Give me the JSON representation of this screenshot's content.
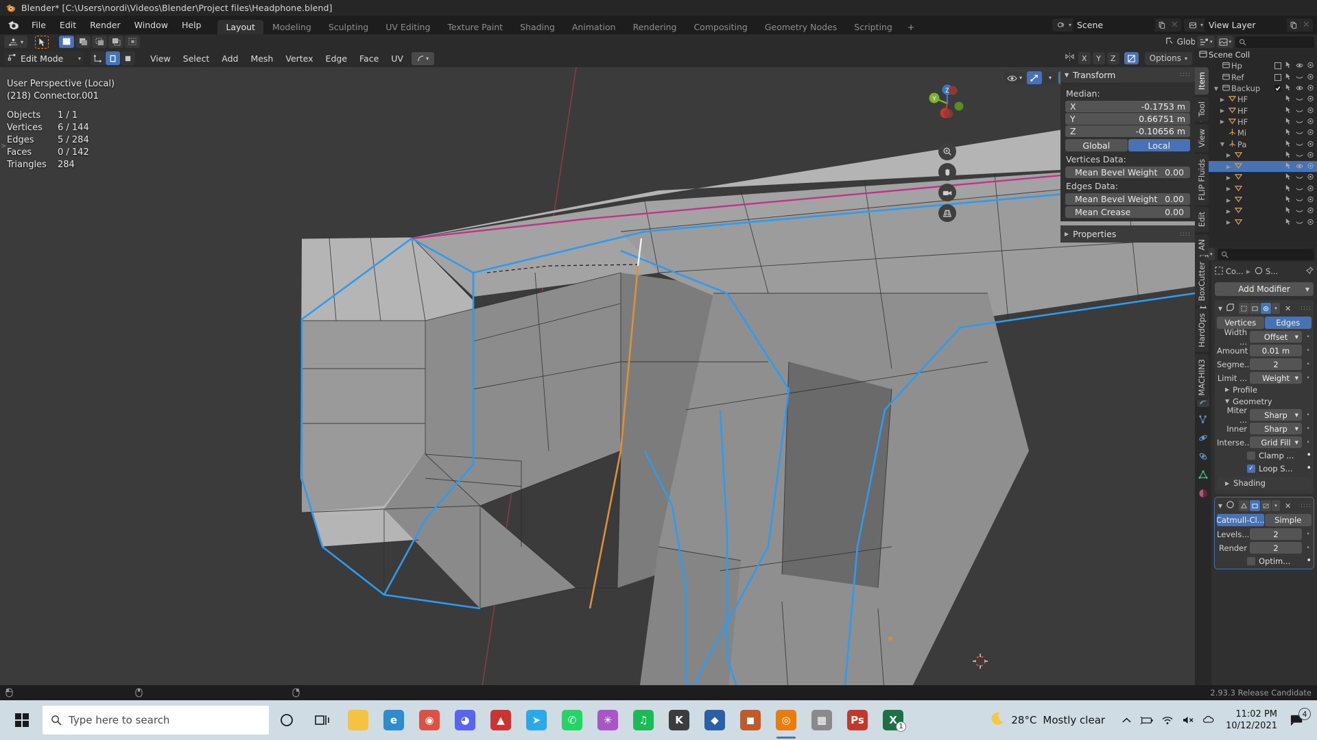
{
  "window": {
    "title": "Blender* [C:\\Users\\nordi\\Videos\\Blender\\Project files\\Headphone.blend]"
  },
  "topbar": {
    "menus": [
      "File",
      "Edit",
      "Render",
      "Window",
      "Help"
    ],
    "workspaces": [
      {
        "label": "Layout",
        "active": true
      },
      {
        "label": "Modeling",
        "active": false
      },
      {
        "label": "Sculpting",
        "active": false
      },
      {
        "label": "UV Editing",
        "active": false
      },
      {
        "label": "Texture Paint",
        "active": false
      },
      {
        "label": "Shading",
        "active": false
      },
      {
        "label": "Animation",
        "active": false
      },
      {
        "label": "Rendering",
        "active": false
      },
      {
        "label": "Compositing",
        "active": false
      },
      {
        "label": "Geometry Nodes",
        "active": false
      },
      {
        "label": "Scripting",
        "active": false
      }
    ],
    "add_workspace": "+",
    "scene_field": "Scene",
    "view_layer_field": "View Layer"
  },
  "tool_settings": {
    "transform_orientation": "Global",
    "proportional_falloff_enabled": false
  },
  "viewport_header": {
    "mode": "Edit Mode",
    "menus": [
      "View",
      "Select",
      "Add",
      "Mesh",
      "Vertex",
      "Edge",
      "Face",
      "UV"
    ],
    "mirror_axes": [
      "X",
      "Y",
      "Z"
    ],
    "options_label": "Options"
  },
  "viewport": {
    "perspective_label": "User Perspective (Local)",
    "object_label": "(218) Connector.001",
    "stats": [
      {
        "key": "Objects",
        "value": "1 / 1"
      },
      {
        "key": "Vertices",
        "value": "6 / 144"
      },
      {
        "key": "Edges",
        "value": "5 / 284"
      },
      {
        "key": "Faces",
        "value": "0 / 142"
      },
      {
        "key": "Triangles",
        "value": "284"
      }
    ],
    "gizmo_axes": [
      "Z",
      "Y",
      "X"
    ]
  },
  "npanel": {
    "tab_labels": [
      "Item",
      "Tool",
      "View",
      "FLIP Fluids",
      "Edit",
      "AN",
      "BoxCutter",
      "HardOps",
      "MACHIN3"
    ],
    "active_tab": "Item",
    "transform_title": "Transform",
    "median_label": "Median:",
    "median": [
      {
        "axis": "X",
        "value": "-0.1753 m"
      },
      {
        "axis": "Y",
        "value": "0.66751 m"
      },
      {
        "axis": "Z",
        "value": "-0.10656 m"
      }
    ],
    "space_toggle": [
      {
        "label": "Global",
        "active": false
      },
      {
        "label": "Local",
        "active": true
      }
    ],
    "vertices_data_label": "Vertices Data:",
    "vertices_rows": [
      {
        "label": "Mean Bevel Weight",
        "value": "0.00"
      }
    ],
    "edges_data_label": "Edges Data:",
    "edges_rows": [
      {
        "label": "Mean Bevel Weight",
        "value": "0.00"
      },
      {
        "label": "Mean Crease",
        "value": "0.00"
      }
    ],
    "properties_section": "Properties"
  },
  "outliner": {
    "scene_collection": "Scene Coll",
    "rows": [
      {
        "name": "Hp",
        "indent": 1,
        "type": "collection",
        "tri": "",
        "checkbox": "empty",
        "eye": "open",
        "dot": false,
        "selected": false
      },
      {
        "name": "Ref",
        "indent": 1,
        "type": "collection",
        "tri": "",
        "checkbox": "empty",
        "eye": "closed",
        "dot": false,
        "selected": false
      },
      {
        "name": "Backup",
        "indent": 1,
        "type": "collection",
        "tri": "▼",
        "checkbox": "checked",
        "eye": "open",
        "dot": false,
        "selected": false
      },
      {
        "name": "HF",
        "indent": 2,
        "type": "mesh",
        "tri": "▶",
        "eye": "closed",
        "dot": true,
        "selected": false
      },
      {
        "name": "HF",
        "indent": 2,
        "type": "mesh",
        "tri": "▶",
        "eye": "closed",
        "dot": true,
        "selected": false
      },
      {
        "name": "HF",
        "indent": 2,
        "type": "mesh",
        "tri": "▶",
        "eye": "closed",
        "dot": true,
        "selected": false
      },
      {
        "name": "Mi",
        "indent": 2,
        "type": "empty",
        "tri": "",
        "eye": "closed",
        "dot": false,
        "selected": false
      },
      {
        "name": "Pa",
        "indent": 2,
        "type": "empty",
        "tri": "▼",
        "eye": "closed",
        "dot": false,
        "selected": false
      },
      {
        "name": "",
        "indent": 3,
        "type": "mesh",
        "tri": "▶",
        "eye": "closed",
        "dot": true,
        "selected": false
      },
      {
        "name": "",
        "indent": 3,
        "type": "mesh",
        "tri": "▶",
        "eye": "open",
        "dot": true,
        "selected": true
      },
      {
        "name": "",
        "indent": 3,
        "type": "mesh",
        "tri": "▶",
        "eye": "closed",
        "dot": true,
        "selected": false
      },
      {
        "name": "",
        "indent": 3,
        "type": "mesh",
        "tri": "▶",
        "eye": "closed",
        "dot": true,
        "selected": false
      },
      {
        "name": "",
        "indent": 3,
        "type": "mesh",
        "tri": "▶",
        "eye": "closed",
        "dot": true,
        "selected": false
      },
      {
        "name": "",
        "indent": 3,
        "type": "mesh",
        "tri": "▶",
        "eye": "closed",
        "dot": true,
        "selected": false
      },
      {
        "name": "",
        "indent": 3,
        "type": "mesh",
        "tri": "▶",
        "eye": "closed",
        "dot": true,
        "selected": false
      }
    ]
  },
  "properties": {
    "breadcrumb_object": "Co...",
    "breadcrumb_modifier": "S...",
    "add_modifier": "Add Modifier",
    "bevel": {
      "affect": [
        {
          "label": "Vertices",
          "active": false
        },
        {
          "label": "Edges",
          "active": true
        }
      ],
      "rows": [
        {
          "label": "Width ...",
          "value": "Offset",
          "kind": "dropdown"
        },
        {
          "label": "Amount",
          "value": "0.01 m",
          "kind": "number"
        },
        {
          "label": "Segme...",
          "value": "2",
          "kind": "number"
        },
        {
          "label": "Limit ...",
          "value": "Weight",
          "kind": "dropdown"
        }
      ],
      "profile_section": "Profile",
      "geometry_section": "Geometry",
      "geometry_rows": [
        {
          "label": "Miter ...",
          "value": "Sharp",
          "kind": "dropdown"
        },
        {
          "label": "Inner",
          "value": "Sharp",
          "kind": "dropdown"
        },
        {
          "label": "Interse...",
          "value": "Grid Fill",
          "kind": "dropdown"
        }
      ],
      "checks": [
        {
          "label": "Clamp ...",
          "checked": false
        },
        {
          "label": "Loop S...",
          "checked": true
        }
      ],
      "shading_section": "Shading"
    },
    "subsurf": {
      "type_toggle": [
        {
          "label": "Catmull-Cl...",
          "active": true
        },
        {
          "label": "Simple",
          "active": false
        }
      ],
      "rows": [
        {
          "label": "Levels...",
          "value": "2"
        },
        {
          "label": "Render",
          "value": "2"
        }
      ],
      "checks": [
        {
          "label": "Optim...",
          "checked": false
        }
      ]
    }
  },
  "statusbar": {
    "version": "2.93.3 Release Candidate"
  },
  "taskbar": {
    "search_placeholder": "Type here to search",
    "weather_temp": "28°C",
    "weather_desc": "Mostly clear",
    "time": "11:02 PM",
    "date": "10/12/2021",
    "notification_count": "4",
    "apps": [
      {
        "name": "file-explorer-icon",
        "color": "#f5c242",
        "glyph": ""
      },
      {
        "name": "edge-icon",
        "color": "#2d8ccd",
        "glyph": "e"
      },
      {
        "name": "chrome-icon",
        "color": "#dd5144",
        "glyph": "◉"
      },
      {
        "name": "discord-icon",
        "color": "#5865f2",
        "glyph": "◕"
      },
      {
        "name": "vlc-icon",
        "color": "#cc3333",
        "glyph": "▲"
      },
      {
        "name": "telegram-icon",
        "color": "#29a9e9",
        "glyph": "➤"
      },
      {
        "name": "whatsapp-icon",
        "color": "#25d366",
        "glyph": "✆"
      },
      {
        "name": "slack-icon",
        "color": "#a855c7",
        "glyph": "✳"
      },
      {
        "name": "spotify-icon",
        "color": "#1db954",
        "glyph": "♫"
      },
      {
        "name": "krita-icon",
        "color": "#3c3c3c",
        "glyph": "K"
      },
      {
        "name": "affinity-icon",
        "color": "#2b5fa8",
        "glyph": "◆"
      },
      {
        "name": "substance-icon",
        "color": "#c05a28",
        "glyph": "◼"
      },
      {
        "name": "blender-icon",
        "color": "#e87d0d",
        "glyph": "◎",
        "running": true
      },
      {
        "name": "store-icon",
        "color": "#8a8a8a",
        "glyph": "▦"
      },
      {
        "name": "photoshop-icon",
        "color": "#c0392b",
        "glyph": "Ps"
      },
      {
        "name": "excel-icon",
        "color": "#1d7044",
        "glyph": "X",
        "badge": "1"
      }
    ]
  },
  "colors": {
    "accent_blue": "#4772b3",
    "selected_edge": "#2d9bf0",
    "active_edge": "#e0903a",
    "crease_edge": "#c0338a",
    "orange": "#e87d0d"
  }
}
